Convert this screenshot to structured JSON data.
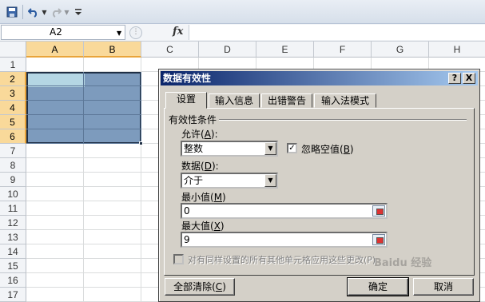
{
  "toolbar": {
    "save_icon": "save-icon",
    "undo_icon": "undo-icon",
    "redo_icon": "redo-icon",
    "customize_icon": "customize-toolbar-icon"
  },
  "formula_bar": {
    "name_box": "A2",
    "fx_label": "fx",
    "formula": ""
  },
  "sheet": {
    "columns": [
      "A",
      "B",
      "C",
      "D",
      "E",
      "F",
      "G",
      "H"
    ],
    "rows": [
      "1",
      "2",
      "3",
      "4",
      "5",
      "6",
      "7",
      "8",
      "9",
      "10",
      "11",
      "12",
      "13",
      "14",
      "15",
      "16",
      "17"
    ],
    "selection": "A2:B6",
    "active_cell": "A2",
    "selection_color": "#7d9bbd",
    "active_color": "#b4d6e4"
  },
  "dialog": {
    "title": "数据有效性",
    "help_button": "?",
    "close_button": "X",
    "tabs": [
      {
        "label": "设置"
      },
      {
        "label": "输入信息"
      },
      {
        "label": "出错警告"
      },
      {
        "label": "输入法模式"
      }
    ],
    "group_label": "有效性条件",
    "allow_label": "允许(",
    "allow_key": "A",
    "allow_label_end": "):",
    "allow_value": "整数",
    "ignore_blank_label": "忽略空值(",
    "ignore_blank_key": "B",
    "ignore_blank_end": ")",
    "ignore_blank_checked": "✓",
    "data_label": "数据(",
    "data_key": "D",
    "data_label_end": "):",
    "data_value": "介于",
    "min_label": "最小值(",
    "min_key": "M",
    "min_label_end": ")",
    "min_value": "0",
    "max_label": "最大值(",
    "max_key": "X",
    "max_label_end": ")",
    "max_value": "9",
    "apply_all_label": "对有同样设置的所有其他单元格应用这些更改(P)",
    "clear_all_label": "全部清除(",
    "clear_all_key": "C",
    "clear_all_end": ")",
    "ok_label": "确定",
    "cancel_label": "取消"
  },
  "watermark": "Baidu 经验"
}
